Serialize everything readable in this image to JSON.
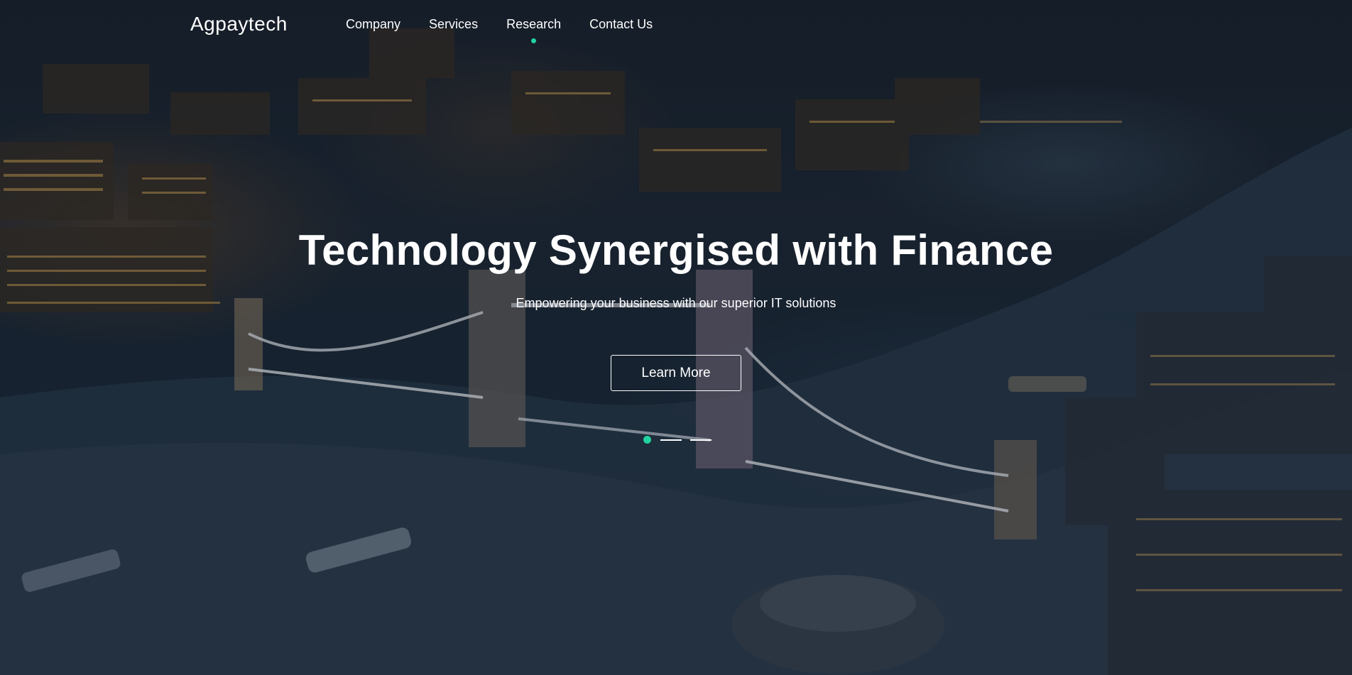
{
  "brand": {
    "name": "Agpaytech",
    "accent": "#21d3a0"
  },
  "nav": {
    "items": [
      {
        "label": "Company",
        "active": false
      },
      {
        "label": "Services",
        "active": false
      },
      {
        "label": "Research",
        "active": true
      },
      {
        "label": "Contact Us",
        "active": false
      }
    ]
  },
  "hero": {
    "headline": "Technology Synergised with Finance",
    "subheadline": "Empowering your business with our superior IT solutions",
    "cta_label": "Learn More",
    "background": "night aerial city view with river and illuminated bridge",
    "slides": {
      "count": 3,
      "active_index": 0
    }
  }
}
